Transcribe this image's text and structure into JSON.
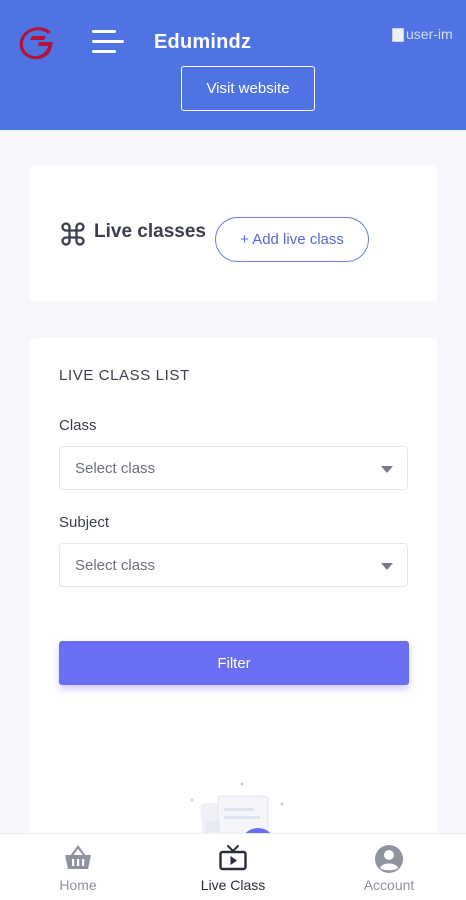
{
  "header": {
    "app_title": "Edumindz",
    "user_image_alt": "user-im",
    "visit_button": "Visit website",
    "colors": {
      "background": "#4f73e3",
      "logo": "#b5123a"
    }
  },
  "live_classes_card": {
    "title": "Live classes",
    "icon": "command-icon",
    "add_button": "+ Add live class"
  },
  "list_card": {
    "title": "LIVE CLASS LIST",
    "class_label": "Class",
    "class_select_value": "Select class",
    "subject_label": "Subject",
    "subject_select_value": "Select class",
    "filter_button": "Filter",
    "accent": "#6a6ef2"
  },
  "bottom_nav": {
    "items": [
      {
        "label": "Home",
        "icon": "basket-icon"
      },
      {
        "label": "Live Class",
        "icon": "tv-play-icon"
      },
      {
        "label": "Account",
        "icon": "user-circle-icon"
      }
    ],
    "active": "Live Class"
  }
}
